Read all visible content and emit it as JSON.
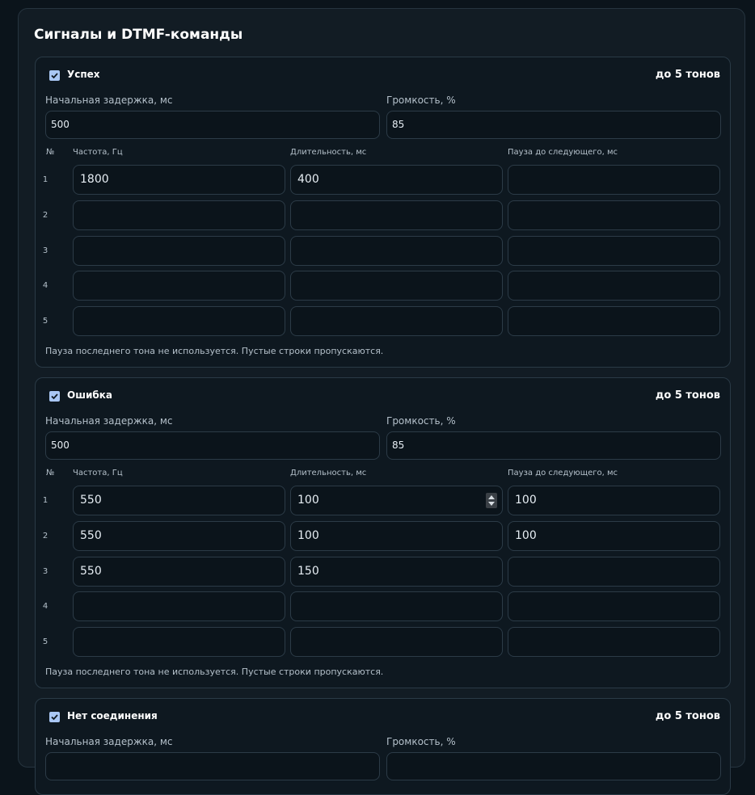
{
  "section_title": "Сигналы и DTMF-команды",
  "labels": {
    "initial_delay": "Начальная задержка, мс",
    "volume": "Громкость, %",
    "num_col": "№",
    "freq_col": "Частота, Гц",
    "duration_col": "Длительность, мс",
    "pause_col": "Пауза до следующего, мс",
    "note": "Пауза последнего тона не используется. Пустые строки пропускаются.",
    "limit": "до 5 тонов"
  },
  "cards": [
    {
      "name": "Успех",
      "enabled": true,
      "initial_delay": "500",
      "volume": "85",
      "rows": [
        {
          "num": "1",
          "freq": "1800",
          "duration": "400",
          "pause": ""
        },
        {
          "num": "2",
          "freq": "",
          "duration": "",
          "pause": ""
        },
        {
          "num": "3",
          "freq": "",
          "duration": "",
          "pause": ""
        },
        {
          "num": "4",
          "freq": "",
          "duration": "",
          "pause": ""
        },
        {
          "num": "5",
          "freq": "",
          "duration": "",
          "pause": ""
        }
      ]
    },
    {
      "name": "Ошибка",
      "enabled": true,
      "initial_delay": "500",
      "volume": "85",
      "rows": [
        {
          "num": "1",
          "freq": "550",
          "duration": "100",
          "pause": "100"
        },
        {
          "num": "2",
          "freq": "550",
          "duration": "100",
          "pause": "100"
        },
        {
          "num": "3",
          "freq": "550",
          "duration": "150",
          "pause": ""
        },
        {
          "num": "4",
          "freq": "",
          "duration": "",
          "pause": ""
        },
        {
          "num": "5",
          "freq": "",
          "duration": "",
          "pause": ""
        }
      ]
    },
    {
      "name": "Нет соединения",
      "enabled": true
    }
  ]
}
